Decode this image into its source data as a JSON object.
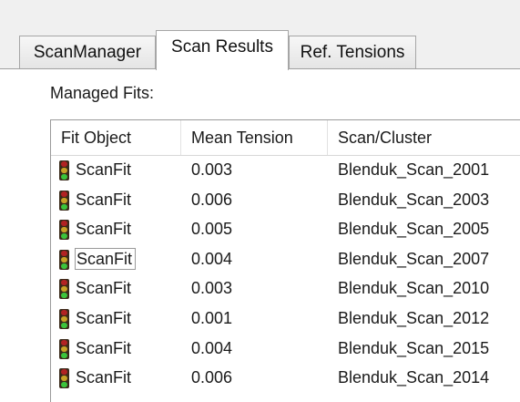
{
  "tabs": [
    {
      "label": "ScanManager",
      "active": false
    },
    {
      "label": "Scan Results",
      "active": true
    },
    {
      "label": "Ref. Tensions",
      "active": false
    }
  ],
  "section_label": "Managed Fits:",
  "columns": [
    "Fit Object",
    "Mean Tension",
    "Scan/Cluster"
  ],
  "rows": [
    {
      "fit_object": "ScanFit",
      "mean_tension": "0.003",
      "scan_cluster": "Blenduk_Scan_2001",
      "status_icon": "traffic-light-green-icon"
    },
    {
      "fit_object": "ScanFit",
      "mean_tension": "0.006",
      "scan_cluster": "Blenduk_Scan_2003",
      "status_icon": "traffic-light-green-icon"
    },
    {
      "fit_object": "ScanFit",
      "mean_tension": "0.005",
      "scan_cluster": "Blenduk_Scan_2005",
      "status_icon": "traffic-light-green-icon"
    },
    {
      "fit_object": "ScanFit",
      "mean_tension": "0.004",
      "scan_cluster": "Blenduk_Scan_2007",
      "status_icon": "traffic-light-green-icon",
      "focused": true
    },
    {
      "fit_object": "ScanFit",
      "mean_tension": "0.003",
      "scan_cluster": "Blenduk_Scan_2010",
      "status_icon": "traffic-light-green-icon"
    },
    {
      "fit_object": "ScanFit",
      "mean_tension": "0.001",
      "scan_cluster": "Blenduk_Scan_2012",
      "status_icon": "traffic-light-green-icon"
    },
    {
      "fit_object": "ScanFit",
      "mean_tension": "0.004",
      "scan_cluster": "Blenduk_Scan_2015",
      "status_icon": "traffic-light-green-icon"
    },
    {
      "fit_object": "ScanFit",
      "mean_tension": "0.006",
      "scan_cluster": "Blenduk_Scan_2014",
      "status_icon": "traffic-light-green-icon"
    }
  ],
  "colors": {
    "light_housing": "#3a2a1a",
    "light_red": "#b22222",
    "light_yellow": "#c9a227",
    "light_green": "#3cc43c"
  }
}
